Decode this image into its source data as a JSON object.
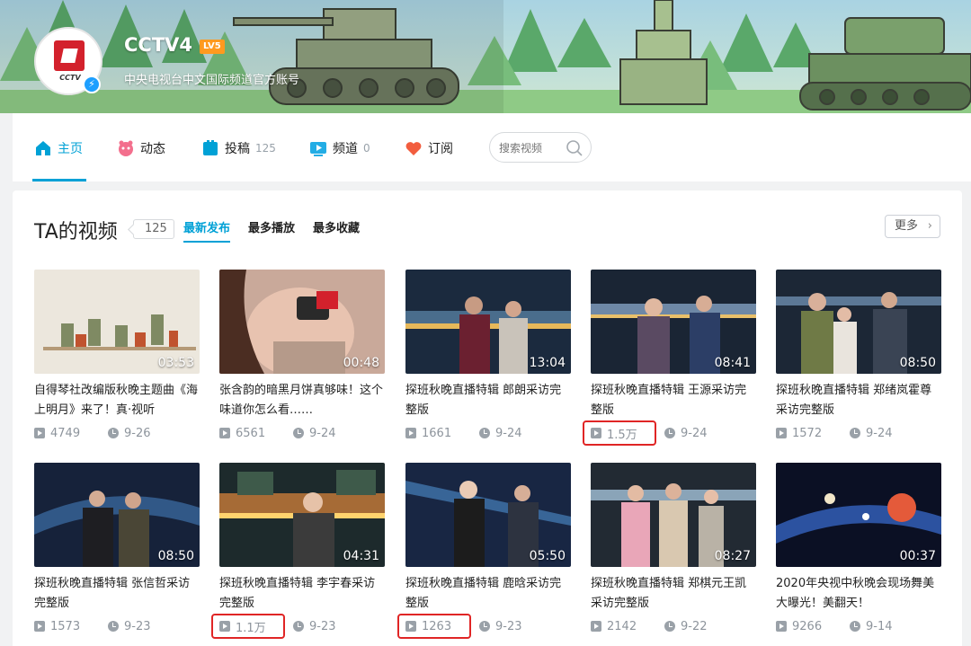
{
  "channel": {
    "name": "CCTV4",
    "level": "LV5",
    "description": "中央电视台中文国际频道官方账号",
    "avatar_logo_text": "CCTV"
  },
  "nav": {
    "items": [
      {
        "label": "主页",
        "icon": "home-icon",
        "count": ""
      },
      {
        "label": "动态",
        "icon": "dynamic-icon",
        "count": ""
      },
      {
        "label": "投稿",
        "icon": "upload-icon",
        "count": "125"
      },
      {
        "label": "频道",
        "icon": "channel-icon",
        "count": "0"
      },
      {
        "label": "订阅",
        "icon": "heart-icon",
        "count": ""
      }
    ],
    "search_placeholder": "搜索视频"
  },
  "videos_section": {
    "title": "TA的视频",
    "count": "125",
    "sort_tabs": [
      "最新发布",
      "最多播放",
      "最多收藏"
    ],
    "more_label": "更多"
  },
  "videos": [
    {
      "title": "自得琴社改编版秋晚主题曲《海上明月》来了！真·视听",
      "duration": "03:53",
      "plays": "4749",
      "date": "9-26"
    },
    {
      "title": "张含韵的暗黑月饼真够味！这个味道你怎么看……",
      "duration": "00:48",
      "plays": "6561",
      "date": "9-24"
    },
    {
      "title": "探班秋晚直播特辑 郎朗采访完整版",
      "duration": "13:04",
      "plays": "1661",
      "date": "9-24"
    },
    {
      "title": "探班秋晚直播特辑 王源采访完整版",
      "duration": "08:41",
      "plays": "1.5万",
      "date": "9-24"
    },
    {
      "title": "探班秋晚直播特辑 郑绪岚霍尊采访完整版",
      "duration": "08:50",
      "plays": "1572",
      "date": "9-24"
    },
    {
      "title": "探班秋晚直播特辑 张信哲采访完整版",
      "duration": "08:50",
      "plays": "1573",
      "date": "9-23"
    },
    {
      "title": "探班秋晚直播特辑 李宇春采访完整版",
      "duration": "04:31",
      "plays": "1.1万",
      "date": "9-23"
    },
    {
      "title": "探班秋晚直播特辑 鹿晗采访完整版",
      "duration": "05:50",
      "plays": "1263",
      "date": "9-23"
    },
    {
      "title": "探班秋晚直播特辑 郑棋元王凯采访完整版",
      "duration": "08:27",
      "plays": "2142",
      "date": "9-22"
    },
    {
      "title": "2020年央视中秋晚会现场舞美大曝光！美翻天！",
      "duration": "00:37",
      "plays": "9266",
      "date": "9-14"
    }
  ],
  "colors": {
    "accent": "#00a1d6",
    "highlight_box": "#e02525",
    "level_badge": "#ff9a1f"
  }
}
